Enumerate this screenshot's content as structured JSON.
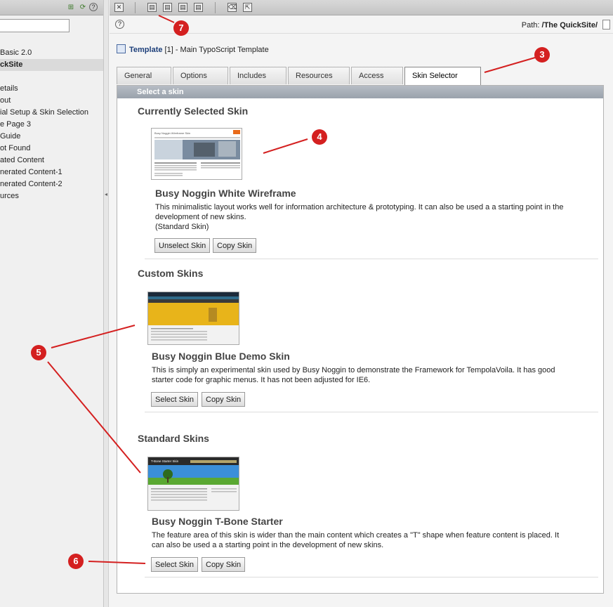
{
  "left_pane": {
    "tree_items": [
      {
        "label": " Basic 2.0",
        "active": false
      },
      {
        "label": "ckSite",
        "active": true
      },
      {
        "label": "",
        "active": false
      },
      {
        "label": "etails",
        "active": false
      },
      {
        "label": "out",
        "active": false
      },
      {
        "label": "ial Setup & Skin Selection",
        "active": false
      },
      {
        "label": "e Page 3",
        "active": false
      },
      {
        "label": " Guide",
        "active": false
      },
      {
        "label": "ot Found",
        "active": false
      },
      {
        "label": "ated Content",
        "active": false
      },
      {
        "label": "nerated Content-1",
        "active": false
      },
      {
        "label": "nerated Content-2",
        "active": false
      },
      {
        "label": "urces",
        "active": false
      }
    ]
  },
  "docbar": {
    "path_label": "Path: ",
    "path_value": "/The QuickSite/"
  },
  "doc_title": {
    "name": "Template",
    "rest": " [1] - Main TypoScript Template"
  },
  "tabs": [
    {
      "label": "General",
      "active": false
    },
    {
      "label": "Options",
      "active": false
    },
    {
      "label": "Includes",
      "active": false
    },
    {
      "label": "Resources",
      "active": false
    },
    {
      "label": "Access",
      "active": false
    },
    {
      "label": "Skin Selector",
      "active": true
    }
  ],
  "panel": {
    "header": "Select a skin",
    "current": {
      "section_title": "Currently Selected Skin",
      "name": "Busy Noggin White Wireframe",
      "desc1": "This minimalistic layout works well for information architecture & prototyping. It can also be used a a starting point in the",
      "desc2": "development of new skins.",
      "desc3": "(Standard Skin)",
      "btn_unselect": "Unselect Skin",
      "btn_copy": "Copy Skin",
      "thumb_title": "Busy Noggin Wireframe Skin"
    },
    "custom": {
      "section_title": "Custom Skins",
      "name": "Busy Noggin Blue Demo Skin",
      "desc1": "This is simply an experimental skin used by Busy Noggin to demonstrate the Framework for TempolaVoila. It has good",
      "desc2": "starter code for graphic menus. It has not been adjusted for IE6.",
      "btn_select": "Select Skin",
      "btn_copy": "Copy Skin"
    },
    "standard": {
      "section_title": "Standard Skins",
      "name": "Busy Noggin T-Bone Starter",
      "desc1": "The feature area of this skin is wider than the main content which creates a \"T\" shape when feature content is placed. It",
      "desc2": "can also be used a a starting point in the development of new skins.",
      "btn_select": "Select Skin",
      "btn_copy": "Copy Skin",
      "thumb_title": "T-Bone Starter Skin"
    }
  },
  "annotations": [
    "7",
    "3",
    "4",
    "5",
    "6"
  ],
  "colors": {
    "badge": "#d42020",
    "accent_title": "#1d3f7a"
  }
}
